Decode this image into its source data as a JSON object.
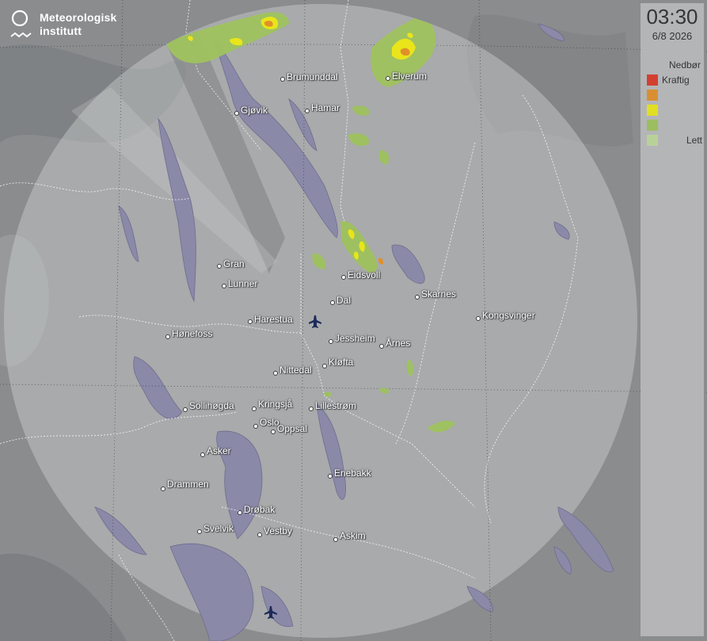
{
  "brand": {
    "line1": "Meteorologisk",
    "line2": "institutt"
  },
  "timestamp": {
    "time": "03:30",
    "date": "6/8 2026"
  },
  "legend": {
    "title": "Nedbør",
    "items": [
      {
        "label": "Kraftig",
        "color": "#d93a2b"
      },
      {
        "label": "",
        "color": "#e0902a"
      },
      {
        "label": "",
        "color": "#e9e51a"
      },
      {
        "label": "",
        "color": "#9fc25e"
      },
      {
        "label": "Lett",
        "color": "#bcd79a"
      }
    ]
  },
  "places": [
    {
      "name": "Brumunddal"
    },
    {
      "name": "Elverum"
    },
    {
      "name": "Gjøvik"
    },
    {
      "name": "Hamar"
    },
    {
      "name": "Gran"
    },
    {
      "name": "Lunner"
    },
    {
      "name": "Eidsvoll"
    },
    {
      "name": "Dal"
    },
    {
      "name": "Skarnes"
    },
    {
      "name": "Kongsvinger"
    },
    {
      "name": "Harestua"
    },
    {
      "name": "Hønefoss"
    },
    {
      "name": "Jessheim"
    },
    {
      "name": "Årnes"
    },
    {
      "name": "Nittedal"
    },
    {
      "name": "Kløfta"
    },
    {
      "name": "Sollihøgda"
    },
    {
      "name": "Kringsjå"
    },
    {
      "name": "Lillestrøm"
    },
    {
      "name": "Oslo"
    },
    {
      "name": "Oppsal"
    },
    {
      "name": "Asker"
    },
    {
      "name": "Enebakk"
    },
    {
      "name": "Drammen"
    },
    {
      "name": "Drøbak"
    },
    {
      "name": "Svelvik"
    },
    {
      "name": "Vestby"
    },
    {
      "name": "Askim"
    }
  ],
  "colors": {
    "terrain": "#8a8c8e",
    "radar_coverage": "#d2d3d4",
    "water": "#8a89a8",
    "border": "#ffffff"
  },
  "icons": {
    "airport": "airplane-icon",
    "logo": "met-logo-icon"
  }
}
